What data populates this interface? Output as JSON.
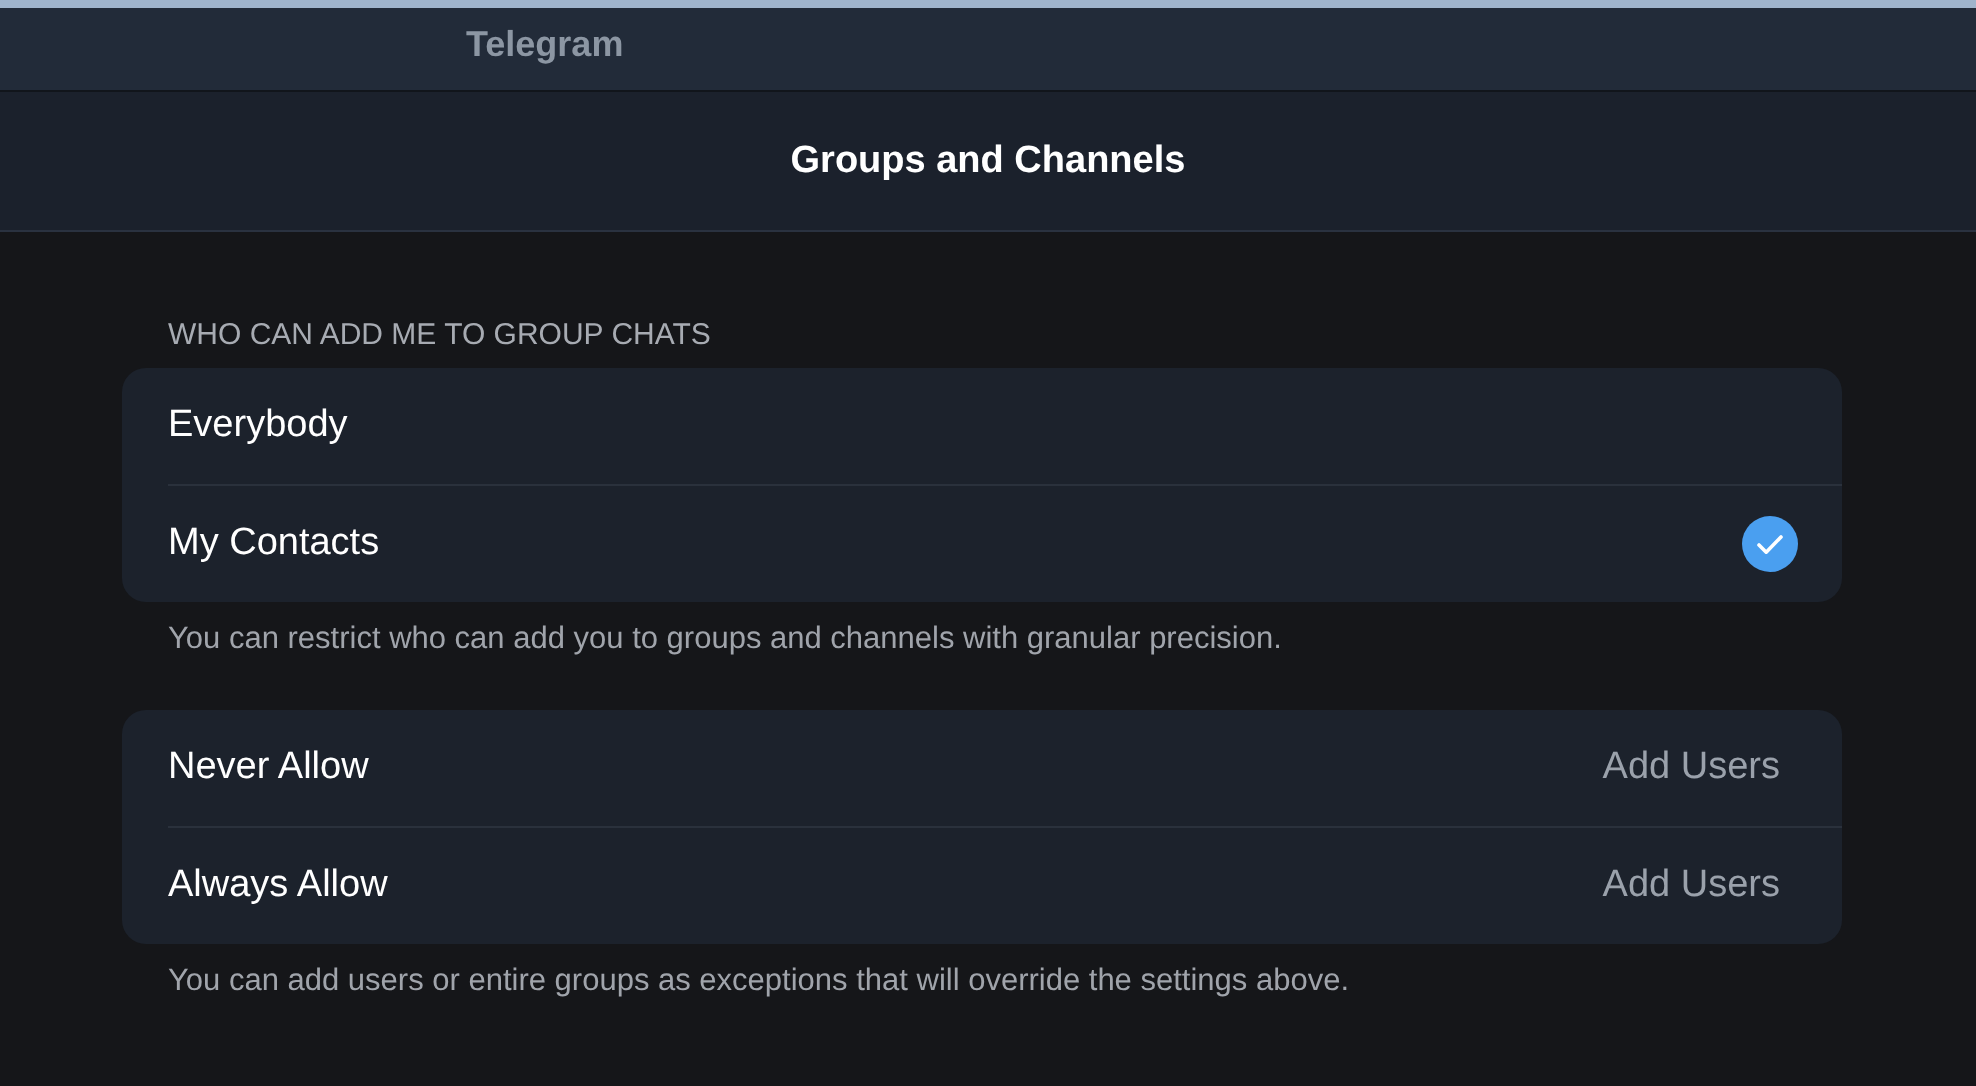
{
  "window": {
    "title": "Telegram"
  },
  "header": {
    "title": "Groups and Channels"
  },
  "sections": [
    {
      "heading": "WHO CAN ADD ME TO GROUP CHATS",
      "rows": [
        {
          "kind": "option",
          "label": "Everybody",
          "selected": false
        },
        {
          "kind": "option",
          "label": "My Contacts",
          "selected": true
        }
      ],
      "footer": "You can restrict who can add you to groups and channels with granular precision."
    },
    {
      "rows": [
        {
          "kind": "link",
          "label": "Never Allow",
          "action": "Add Users"
        },
        {
          "kind": "link",
          "label": "Always Allow",
          "action": "Add Users"
        }
      ],
      "footer": "You can add users or entire groups as exceptions that will override the settings above."
    }
  ]
}
